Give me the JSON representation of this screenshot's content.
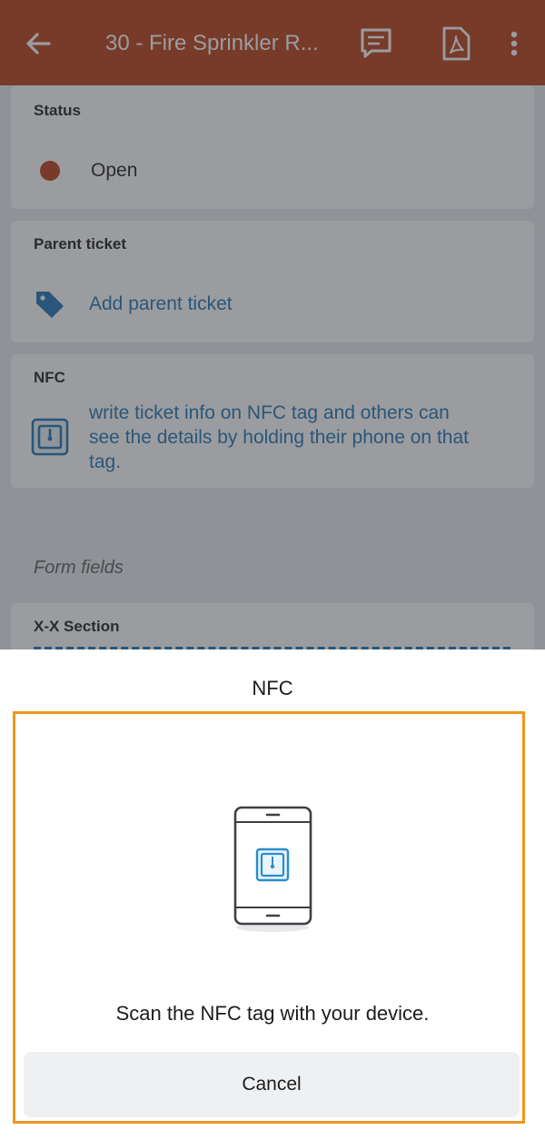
{
  "appbar": {
    "title": "30 - Fire Sprinkler R...",
    "back_icon": "arrow-left-icon",
    "comment_icon": "comment-icon",
    "pdf_icon": "pdf-icon",
    "more_icon": "more-vertical-icon",
    "color": "#b83c12"
  },
  "status": {
    "header": "Status",
    "value": "Open",
    "dot_color": "#b83c12"
  },
  "parent_ticket": {
    "header": "Parent ticket",
    "link": "Add parent ticket",
    "icon": "tag-icon"
  },
  "nfc_card": {
    "header": "NFC",
    "line1": "write ticket info on NFC tag and others can",
    "line2": "see the details by holding their phone on that",
    "line3": "tag.",
    "icon": "nfc-icon"
  },
  "form_fields": {
    "label": "Form fields",
    "section_header": "X-X Section"
  },
  "sheet": {
    "title": "NFC",
    "scan_text": "Scan the NFC tag with your device.",
    "cancel_label": "Cancel",
    "illustration": "phone-nfc-icon",
    "highlight_color": "#f0961e"
  }
}
